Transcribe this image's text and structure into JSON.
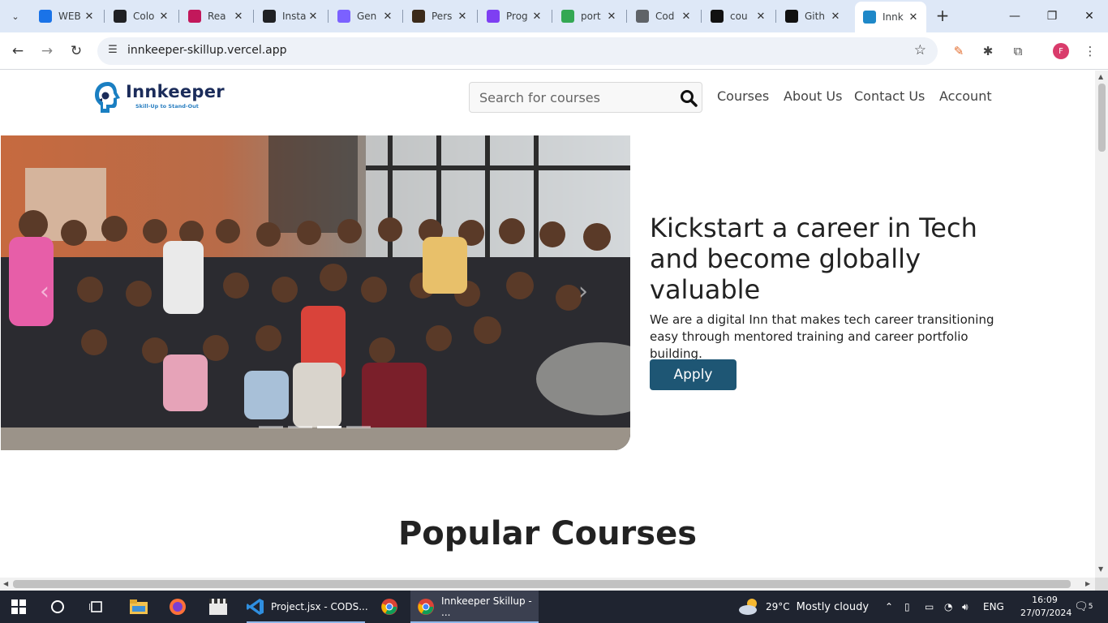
{
  "browser": {
    "tabs": [
      {
        "title": "WEB",
        "color": "#1a73e8"
      },
      {
        "title": "Colo",
        "color": "#202124"
      },
      {
        "title": "Rea",
        "color": "#c2185b"
      },
      {
        "title": "Insta",
        "color": "#202124"
      },
      {
        "title": "Gen",
        "color": "#7b61ff"
      },
      {
        "title": "Pers",
        "color": "#3b2a1a"
      },
      {
        "title": "Prog",
        "color": "#7e3ff2"
      },
      {
        "title": "port",
        "color": "#34a853"
      },
      {
        "title": "Cod",
        "color": "#5f6368"
      },
      {
        "title": "cou",
        "color": "#111111"
      },
      {
        "title": "Gith",
        "color": "#111111"
      },
      {
        "title": "Innk",
        "color": "#1e88c8"
      }
    ],
    "active_tab_index": 11,
    "url": "innkeeper-skillup.vercel.app",
    "profile_initial": "F"
  },
  "site": {
    "logo_name": "Innkeeper",
    "logo_tagline": "Skill-Up to Stand-Out",
    "search_placeholder": "Search for courses",
    "nav": [
      "Courses",
      "About Us",
      "Contact Us",
      "Account"
    ],
    "hero_title": "Kickstart a career in Tech and become globally valuable",
    "hero_subtitle": "We are a digital Inn that makes tech career transitioning easy through mentored training and career portfolio building.",
    "apply_label": "Apply",
    "carousel_slides": 4,
    "carousel_active": 2,
    "popular_title": "Popular Courses",
    "accent_color": "#1e5674"
  },
  "taskbar": {
    "apps": [
      {
        "label": "Project.jsx - CODS..."
      },
      {
        "label": "Innkeeper Skillup - ..."
      }
    ],
    "weather_temp": "29°C",
    "weather_text": "Mostly cloudy",
    "language": "ENG",
    "time": "16:09",
    "date": "27/07/2024",
    "notifications": "5"
  }
}
